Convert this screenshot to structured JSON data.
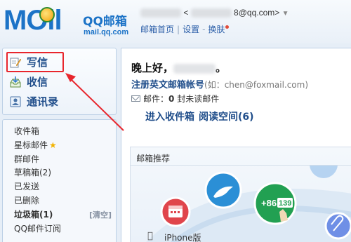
{
  "header": {
    "logo_word": "MOil",
    "logo_cn": "QQ邮箱",
    "logo_domain": "mail.qq.com",
    "account_prefix": "<",
    "account_suffix": "8@qq.com>",
    "account_caret": "▼",
    "links": [
      "邮箱首页",
      "设置",
      "换肤"
    ]
  },
  "sidebar": {
    "actions": [
      {
        "label": "写信",
        "icon": "pencil-icon"
      },
      {
        "label": "收信",
        "icon": "inbox-icon"
      },
      {
        "label": "通讯录",
        "icon": "contacts-icon"
      }
    ],
    "folders": [
      {
        "label": "收件箱"
      },
      {
        "label": "星标邮件",
        "star": "★"
      },
      {
        "label": "群邮件"
      },
      {
        "label": "草稿箱(2)"
      },
      {
        "label": "已发送"
      },
      {
        "label": "已删除"
      },
      {
        "label": "垃圾箱(1)",
        "bold": true,
        "action": "[清空]"
      },
      {
        "label": "QQ邮件订阅"
      }
    ]
  },
  "main": {
    "greeting": "晚上好，",
    "greeting_end": "。",
    "register_link": "注册英文邮箱帐号",
    "register_hint": "(如：chen@foxmail.com)",
    "mail_label": "邮件：",
    "mail_count": "0",
    "mail_suffix": "封未读邮件",
    "quick_links": [
      "进入收件箱",
      "阅读空间(6)"
    ],
    "promo_title": "邮箱推荐",
    "promo_badge": "+86",
    "promo_number": "139",
    "promo_footer": "iPhone版"
  },
  "colors": {
    "brand_blue": "#1c73c7",
    "link_blue": "#1f4d8a",
    "highlight_red": "#e8262d"
  }
}
